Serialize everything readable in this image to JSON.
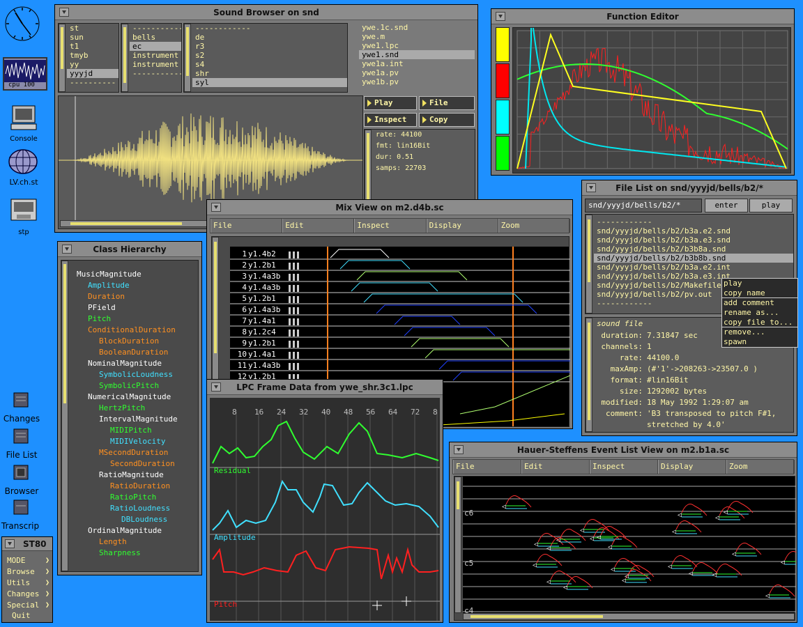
{
  "desktop": {
    "cpu_label": "cpu 100",
    "console": "Console",
    "lv": "LV.ch.st",
    "stp": "stp",
    "changes": "Changes",
    "file_list": "File List",
    "browser": "Browser",
    "transcript": "Transcrip"
  },
  "st80": {
    "title": "ST80",
    "items": [
      "MODE",
      "Browse",
      "Utils",
      "Changes",
      "Special"
    ],
    "quit": "Quit"
  },
  "sound_browser": {
    "title": "Sound Browser on snd",
    "list1": [
      "st",
      "sun",
      "t1",
      "tmyb",
      "yy",
      "yyyjd",
      "----------"
    ],
    "list1_sel": 5,
    "list2": [
      "------------",
      "bells",
      "ec",
      "instrument",
      "instrument",
      "------------"
    ],
    "list2_sel": 2,
    "list3": [
      "------------",
      "de",
      "r3",
      "s2",
      "s4",
      "shr",
      "syl"
    ],
    "list3_sel": 6,
    "list4": [
      "ywe.1c.snd",
      "ywe.m",
      "ywe1.lpc",
      "ywe1.snd",
      "ywe1a.int",
      "ywe1a.pv",
      "ywe1b.pv"
    ],
    "list4_sel": 3,
    "buttons": {
      "play": "Play",
      "file": "File",
      "inspect": "Inspect",
      "copy": "Copy"
    },
    "info": {
      "rate": "rate: 44100",
      "fmt": "fmt: lin16Bit",
      "dur": "dur: 0.51",
      "samps": "samps: 22703"
    }
  },
  "function_editor": {
    "title": "Function Editor",
    "swatches": [
      "#ffff00",
      "#ff0000",
      "#00ffff",
      "#00ff00"
    ]
  },
  "file_list": {
    "title": "File List on snd/yyyjd/bells/b2/*",
    "path": "snd/yyyjd/bells/b2/*",
    "enter": "enter",
    "play": "play",
    "files": [
      "------------",
      "snd/yyyjd/bells/b2/b3a.e2.snd",
      "snd/yyyjd/bells/b2/b3a.e3.snd",
      "snd/yyyjd/bells/b2/b3b8a.snd",
      "snd/yyyjd/bells/b2/b3b8b.snd",
      "snd/yyyjd/bells/b2/b3a.e2.int",
      "snd/yyyjd/bells/b2/b3a.e3.int",
      "snd/yyyjd/bells/b2/Makefile",
      "snd/yyyjd/bells/b2/pv.out",
      "------------"
    ],
    "sel": 4,
    "info_header": "sound file",
    "info": [
      [
        "duration:",
        "7.31847 sec"
      ],
      [
        "channels:",
        "1"
      ],
      [
        "rate:",
        "44100.0"
      ],
      [
        "maxAmp:",
        "(#'1'->208263->23507.0 )"
      ],
      [
        "format:",
        "#lin16Bit"
      ],
      [
        "size:",
        "1292002 bytes"
      ],
      [
        "modified:",
        "18 May 1992   1:29:07 am"
      ],
      [
        "comment:",
        "'B3 transposed to pitch F#1,"
      ],
      [
        "",
        "  stretched by 4.0'"
      ]
    ],
    "popup": [
      "play",
      "copy name",
      "add comment",
      "rename as...",
      "copy file to...",
      "remove...",
      "spawn"
    ]
  },
  "class_hierarchy": {
    "title": "Class Hierarchy",
    "items": [
      [
        "MusicMagnitude",
        0,
        "#ffffff"
      ],
      [
        "Amplitude",
        1,
        "#40e0ff"
      ],
      [
        "Duration",
        1,
        "#ff9020"
      ],
      [
        "PField",
        1,
        "#ffffff"
      ],
      [
        "Pitch",
        1,
        "#30ff30"
      ],
      [
        "ConditionalDuration",
        1,
        "#ff9020"
      ],
      [
        "BlockDuration",
        2,
        "#ff9020"
      ],
      [
        "BooleanDuration",
        2,
        "#ff9020"
      ],
      [
        "NominalMagnitude",
        1,
        "#ffffff"
      ],
      [
        "SymbolicLoudness",
        2,
        "#40e0ff"
      ],
      [
        "SymbolicPitch",
        2,
        "#30ff30"
      ],
      [
        "NumericalMagnitude",
        1,
        "#ffffff"
      ],
      [
        "HertzPitch",
        2,
        "#30ff30"
      ],
      [
        "IntervalMagnitude",
        2,
        "#ffffff"
      ],
      [
        "MIDIPitch",
        3,
        "#30ff30"
      ],
      [
        "MIDIVelocity",
        3,
        "#40e0ff"
      ],
      [
        "MSecondDuration",
        2,
        "#ff9020"
      ],
      [
        "SecondDuration",
        3,
        "#ff9020"
      ],
      [
        "RatioMagnitude",
        2,
        "#ffffff"
      ],
      [
        "RatioDuration",
        3,
        "#ff9020"
      ],
      [
        "RatioPitch",
        3,
        "#30ff30"
      ],
      [
        "RatioLoudness",
        3,
        "#40e0ff"
      ],
      [
        "DBLoudness",
        4,
        "#40e0ff"
      ],
      [
        "OrdinalMagnitude",
        1,
        "#ffffff"
      ],
      [
        "Length",
        2,
        "#ff9020"
      ],
      [
        "Sharpness",
        2,
        "#30ff30"
      ]
    ]
  },
  "mix_view": {
    "title": "Mix View on m2.d4b.sc",
    "menu": [
      "File",
      "Edit",
      "Inspect",
      "Display",
      "Zoom"
    ],
    "rows": [
      [
        "1",
        "y1.4b2"
      ],
      [
        "2",
        "y1.2b1"
      ],
      [
        "3",
        "y1.4a3b"
      ],
      [
        "4",
        "y1.4a3b"
      ],
      [
        "5",
        "y1.2b1"
      ],
      [
        "6",
        "y1.4a3b"
      ],
      [
        "7",
        "y1.4a1"
      ],
      [
        "8",
        "y1.2c4"
      ],
      [
        "9",
        "y1.2b1"
      ],
      [
        "10",
        "y1.4a1"
      ],
      [
        "11",
        "y1.4a3b"
      ],
      [
        "12",
        "y1.2b1"
      ]
    ]
  },
  "lpc": {
    "title": "LPC Frame Data from ywe_shr.3c1.lpc",
    "ticks": [
      "8",
      "16",
      "24",
      "32",
      "40",
      "48",
      "56",
      "64",
      "72",
      "8"
    ],
    "residual": "Residual",
    "amplitude": "Amplitude",
    "pitch": "Pitch"
  },
  "event_list": {
    "title": "Hauer-Steffens Event List View on m2.b1a.sc",
    "menu": [
      "File",
      "Edit",
      "Inspect",
      "Display",
      "Zoom"
    ],
    "c6": "c6",
    "c5": "c5",
    "c4": "c4"
  }
}
